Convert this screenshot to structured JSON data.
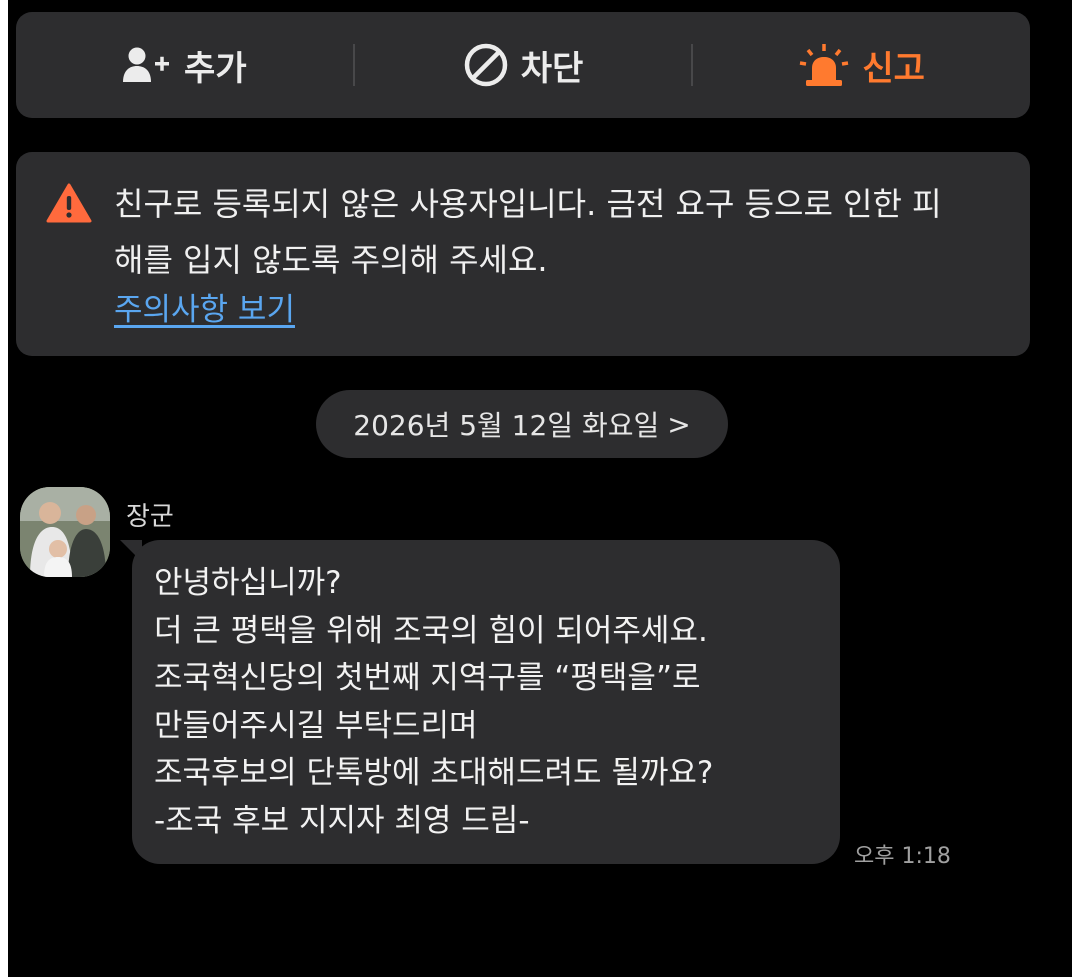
{
  "action_bar": {
    "add_label": "추가",
    "block_label": "차단",
    "report_label": "신고",
    "add_icon": "person-add-icon",
    "block_icon": "block-icon",
    "report_icon": "siren-icon",
    "report_color": "#ff7a2f"
  },
  "warning": {
    "icon": "warning-triangle-icon",
    "line1": "친구로 등록되지 않은 사용자입니다. 금전 요구 등으로 인한 피",
    "line2": "해를 입지 않도록 주의해 주세요.",
    "link_text": "주의사항 보기",
    "icon_color": "#ff6a3d",
    "link_color": "#5aa6f0"
  },
  "date_divider": {
    "label": "2026년 5월 12일 화요일",
    "chevron": ">"
  },
  "message": {
    "sender": "장군",
    "lines": [
      "안녕하십니까?",
      "더 큰 평택을 위해 조국의 힘이 되어주세요.",
      "조국혁신당의 첫번째 지역구를 “평택을”로",
      "만들어주시길 부탁드리며",
      "조국후보의 단톡방에 초대해드려도 될까요?",
      "-조국 후보 지지자 최영 드림-"
    ],
    "time": "오후 1:18"
  },
  "colors": {
    "background": "#000000",
    "card": "#2d2d2f"
  }
}
